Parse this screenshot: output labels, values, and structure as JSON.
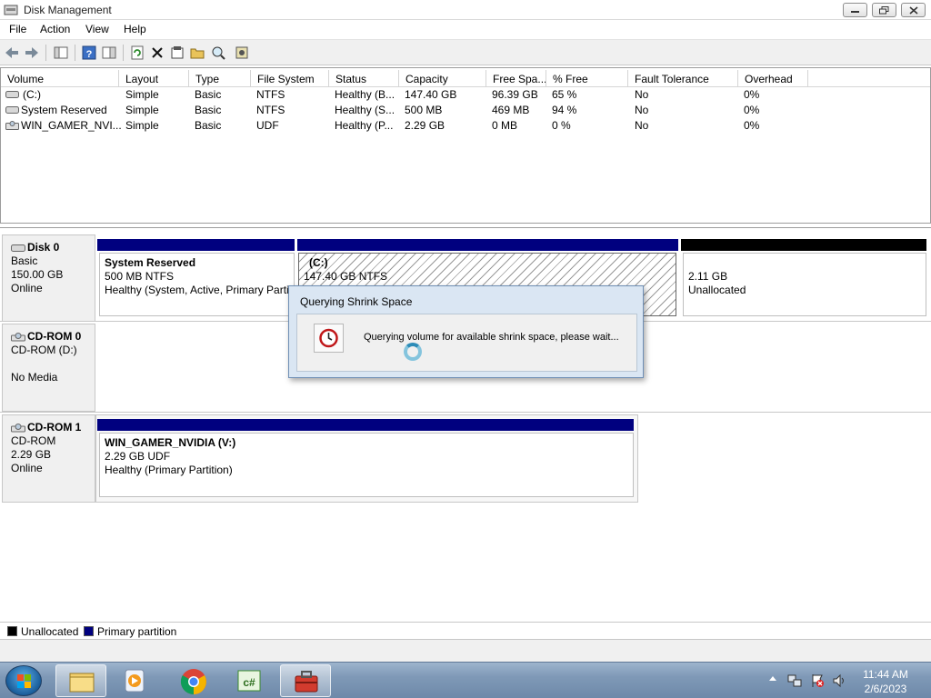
{
  "window": {
    "title": "Disk Management"
  },
  "menu": [
    "File",
    "Action",
    "View",
    "Help"
  ],
  "volume_list": {
    "columns": [
      "Volume",
      "Layout",
      "Type",
      "File System",
      "Status",
      "Capacity",
      "Free Spa...",
      "% Free",
      "Fault Tolerance",
      "Overhead"
    ],
    "rows": [
      [
        "(C:)",
        "Simple",
        "Basic",
        "NTFS",
        "Healthy (B...",
        "147.40 GB",
        "96.39 GB",
        "65 %",
        "No",
        "0%"
      ],
      [
        "System Reserved",
        "Simple",
        "Basic",
        "NTFS",
        "Healthy (S...",
        "500 MB",
        "469 MB",
        "94 %",
        "No",
        "0%"
      ],
      [
        "WIN_GAMER_NVI...",
        "Simple",
        "Basic",
        "UDF",
        "Healthy (P...",
        "2.29 GB",
        "0 MB",
        "0 %",
        "No",
        "0%"
      ]
    ]
  },
  "disks": {
    "disk0": {
      "name": "Disk 0",
      "type": "Basic",
      "size": "150.00 GB",
      "state": "Online",
      "partitions": [
        {
          "name": "System Reserved",
          "detail": "500 MB NTFS",
          "status": "Healthy (System, Active, Primary Partit"
        },
        {
          "name": "(C:)",
          "detail": "147.40 GB NTFS"
        },
        {
          "name": "",
          "detail": "2.11 GB",
          "status": "Unallocated"
        }
      ]
    },
    "cdrom0": {
      "name": "CD-ROM 0",
      "drive": "CD-ROM (D:)",
      "media": "No Media"
    },
    "cdrom1": {
      "name": "CD-ROM 1",
      "drive": "CD-ROM",
      "size": "2.29 GB",
      "state": "Online",
      "partition": {
        "name": "WIN_GAMER_NVIDIA  (V:)",
        "detail": "2.29 GB UDF",
        "status": "Healthy (Primary Partition)"
      }
    }
  },
  "legend": {
    "unallocated": "Unallocated",
    "primary": "Primary partition"
  },
  "dialog": {
    "title": "Querying Shrink Space",
    "message": "Querying volume for available shrink space, please wait..."
  },
  "clock": {
    "time": "11:44 AM",
    "date": "2/6/2023"
  },
  "colors": {
    "primary": "#00007f",
    "unallocated": "#000000",
    "dialog_frame": "#dae6f3"
  }
}
